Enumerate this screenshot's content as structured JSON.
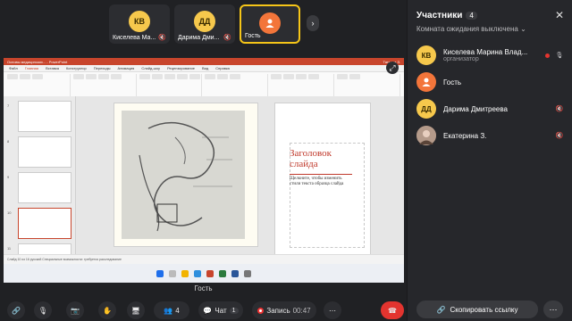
{
  "tiles": [
    {
      "initials": "КВ",
      "name": "Киселева Ма...",
      "color": "#f6c84c",
      "muted": true
    },
    {
      "initials": "ДД",
      "name": "Дарима Дми...",
      "color": "#f6c84c",
      "muted": true
    },
    {
      "initials": "",
      "name": "Гость",
      "color": "#f3753a",
      "muted": false,
      "active": true
    }
  ],
  "screen": {
    "owner": "Гость",
    "ppt_title": "Основы медицинских... - PowerPoint",
    "ppt_user": "Татьяна З.",
    "tabs": [
      "Файл",
      "Главная",
      "Вставка",
      "Конструктор",
      "Переходы",
      "Анимация",
      "Слайд-шоу",
      "Рецензирование",
      "Вид",
      "Справка"
    ],
    "thumbs": [
      "7",
      "8",
      "9",
      "10",
      "11"
    ],
    "layout_title": "Заголовок слайда",
    "layout_subtitle": "Щелкните, чтобы изменить стили текста образца слайда",
    "status_text": "Слайд 10 из 16   русский   Специальные возможности: требуется расследование",
    "clock": "10:00"
  },
  "toolbar": {
    "participants_count": "4",
    "chat_label": "Чат",
    "chat_count": "1",
    "record_label": "Запись",
    "record_time": "00:47"
  },
  "panel": {
    "title": "Участники",
    "count": "4",
    "waiting": "Комната ожидания выключена",
    "participants": [
      {
        "initials": "КВ",
        "name": "Киселева Марина Влад...",
        "role": "организатор",
        "color": "#f6c84c",
        "muted": false,
        "recording": true
      },
      {
        "initials": "",
        "name": "Гость",
        "role": "",
        "color": "#f3753a",
        "muted": false,
        "recording": false
      },
      {
        "initials": "ДД",
        "name": "Дарима Дмитреева",
        "role": "",
        "color": "#f6c84c",
        "muted": true,
        "recording": false
      },
      {
        "initials": "",
        "name": "Екатерина З.",
        "role": "",
        "color": "#8a6a5a",
        "muted": true,
        "recording": false
      }
    ],
    "copy_link": "Скопировать ссылку"
  },
  "icons": {
    "mic_off": "mic-off-icon",
    "person": "person-icon",
    "link": "link-icon",
    "close": "close-icon"
  }
}
